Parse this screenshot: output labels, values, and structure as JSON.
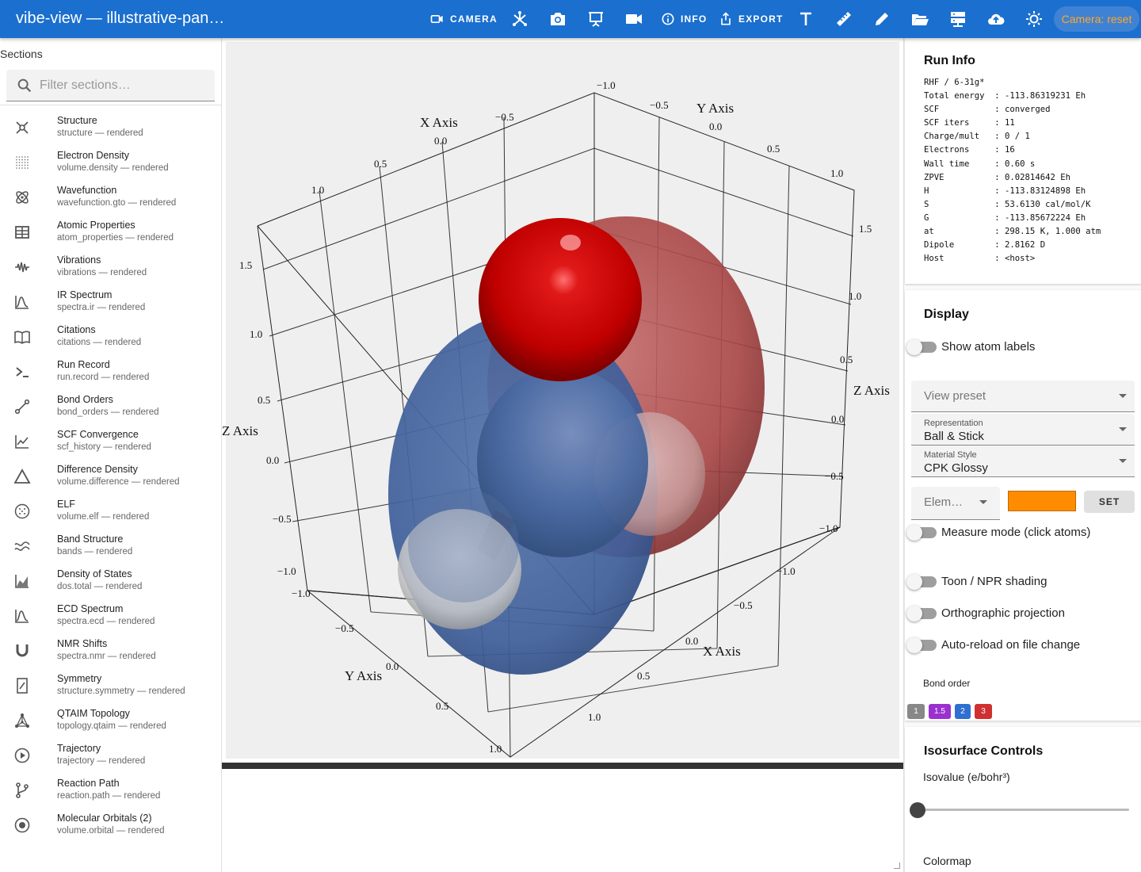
{
  "app": {
    "title": "vibe-view — illustrative-pan…"
  },
  "toolbar": {
    "camera_label": "CAMERA",
    "info_label": "INFO",
    "export_label": "EXPORT",
    "camera_chip": "Camera: reset",
    "icons": [
      "axes-icon",
      "screenshot-icon",
      "presentation-icon",
      "video-icon",
      "text-icon",
      "ruler-icon",
      "pencil-icon",
      "folder-open-icon",
      "server-icon",
      "cloud-upload-icon",
      "brightness-icon"
    ]
  },
  "sidebar": {
    "heading": "Sections",
    "filter_placeholder": "Filter sections…",
    "items": [
      {
        "title": "Structure",
        "sub": "structure — rendered",
        "icon": "molecule-icon"
      },
      {
        "title": "Electron Density",
        "sub": "volume.density — rendered",
        "icon": "grid-dots-icon"
      },
      {
        "title": "Wavefunction",
        "sub": "wavefunction.gto — rendered",
        "icon": "atom-icon"
      },
      {
        "title": "Atomic Properties",
        "sub": "atom_properties — rendered",
        "icon": "table-icon"
      },
      {
        "title": "Vibrations",
        "sub": "vibrations — rendered",
        "icon": "waveform-icon"
      },
      {
        "title": "IR Spectrum",
        "sub": "spectra.ir — rendered",
        "icon": "spectrum-icon"
      },
      {
        "title": "Citations",
        "sub": "citations — rendered",
        "icon": "book-icon"
      },
      {
        "title": "Run Record",
        "sub": "run.record — rendered",
        "icon": "terminal-icon"
      },
      {
        "title": "Bond Orders",
        "sub": "bond_orders — rendered",
        "icon": "bond-icon"
      },
      {
        "title": "SCF Convergence",
        "sub": "scf_history — rendered",
        "icon": "line-chart-icon"
      },
      {
        "title": "Difference Density",
        "sub": "volume.difference — rendered",
        "icon": "triangle-icon"
      },
      {
        "title": "ELF",
        "sub": "volume.elf — rendered",
        "icon": "dotted-circle-icon"
      },
      {
        "title": "Band Structure",
        "sub": "bands — rendered",
        "icon": "bands-icon"
      },
      {
        "title": "Density of States",
        "sub": "dos.total — rendered",
        "icon": "area-chart-icon"
      },
      {
        "title": "ECD Spectrum",
        "sub": "spectra.ecd — rendered",
        "icon": "spectrum-icon"
      },
      {
        "title": "NMR Shifts",
        "sub": "spectra.nmr — rendered",
        "icon": "magnet-icon"
      },
      {
        "title": "Symmetry",
        "sub": "structure.symmetry — rendered",
        "icon": "symmetry-icon"
      },
      {
        "title": "QTAIM Topology",
        "sub": "topology.qtaim — rendered",
        "icon": "topology-icon"
      },
      {
        "title": "Trajectory",
        "sub": "trajectory — rendered",
        "icon": "play-circle-icon"
      },
      {
        "title": "Reaction Path",
        "sub": "reaction.path — rendered",
        "icon": "branch-icon"
      },
      {
        "title": "Molecular Orbitals (2)",
        "sub": "volume.orbital — rendered",
        "icon": "orbital-icon"
      }
    ]
  },
  "viewer": {
    "axes": {
      "x_title": "X Axis",
      "y_title": "Y Axis",
      "z_title": "Z Axis",
      "top_x_ticks": [
        "1.0",
        "0.5",
        "0.0",
        "−0.5",
        "−1.0"
      ],
      "top_y_ticks": [
        "−0.5",
        "0.0",
        "0.5",
        "1.0"
      ],
      "right_z_ticks": [
        "1.5",
        "1.0",
        "0.5",
        "0.0",
        "−0.5",
        "−1.0"
      ],
      "left_z_ticks": [
        "1.5",
        "1.0",
        "0.5",
        "0.0",
        "−0.5",
        "−1.0"
      ],
      "bottom_y_ticks": [
        "−1.0",
        "−0.5",
        "0.0",
        "0.5",
        "1.0"
      ],
      "bottom_x_ticks": [
        "−1.0",
        "−0.5",
        "0.0",
        "0.5",
        "1.0"
      ]
    },
    "colors": {
      "positive_lobe": "#a83a3a",
      "negative_lobe": "#3f5f9a",
      "oxygen": "#d40000",
      "hydrogen": "#d8d8d8"
    }
  },
  "run_info": {
    "title": "Run Info",
    "lines": [
      "RHF / 6-31g*",
      "Total energy  : -113.86319231 Eh",
      "SCF           : converged",
      "SCF iters     : 11",
      "Charge/mult   : 0 / 1",
      "Electrons     : 16",
      "Wall time     : 0.60 s",
      "ZPVE          : 0.02814642 Eh",
      "H             : -113.83124898 Eh",
      "S             : 53.6130 cal/mol/K",
      "G             : -113.85672224 Eh",
      "at            : 298.15 K, 1.000 atm",
      "Dipole        : 2.8162 D",
      "Host          : <host>"
    ]
  },
  "display": {
    "title": "Display",
    "show_atom_labels": "Show atom labels",
    "view_preset": "View preset",
    "representation_label": "Representation",
    "representation_value": "Ball & Stick",
    "material_label": "Material Style",
    "material_value": "CPK Glossy",
    "element_placeholder": "Elem…",
    "element_color": "#ff8c00",
    "set_label": "SET",
    "measure_mode": "Measure mode (click atoms)",
    "toon": "Toon / NPR shading",
    "ortho": "Orthographic projection",
    "autoreload": "Auto-reload on file change",
    "bond_order_label": "Bond order",
    "bond_orders": [
      {
        "label": "1",
        "color": "#888888"
      },
      {
        "label": "1.5",
        "color": "#9b30d0"
      },
      {
        "label": "2",
        "color": "#2f6fd0"
      },
      {
        "label": "3",
        "color": "#d03030"
      }
    ]
  },
  "isosurface": {
    "title": "Isosurface Controls",
    "isovalue_label": "Isovalue (e/bohr³)",
    "isovalue_fraction": 0,
    "colormap_label": "Colormap"
  }
}
